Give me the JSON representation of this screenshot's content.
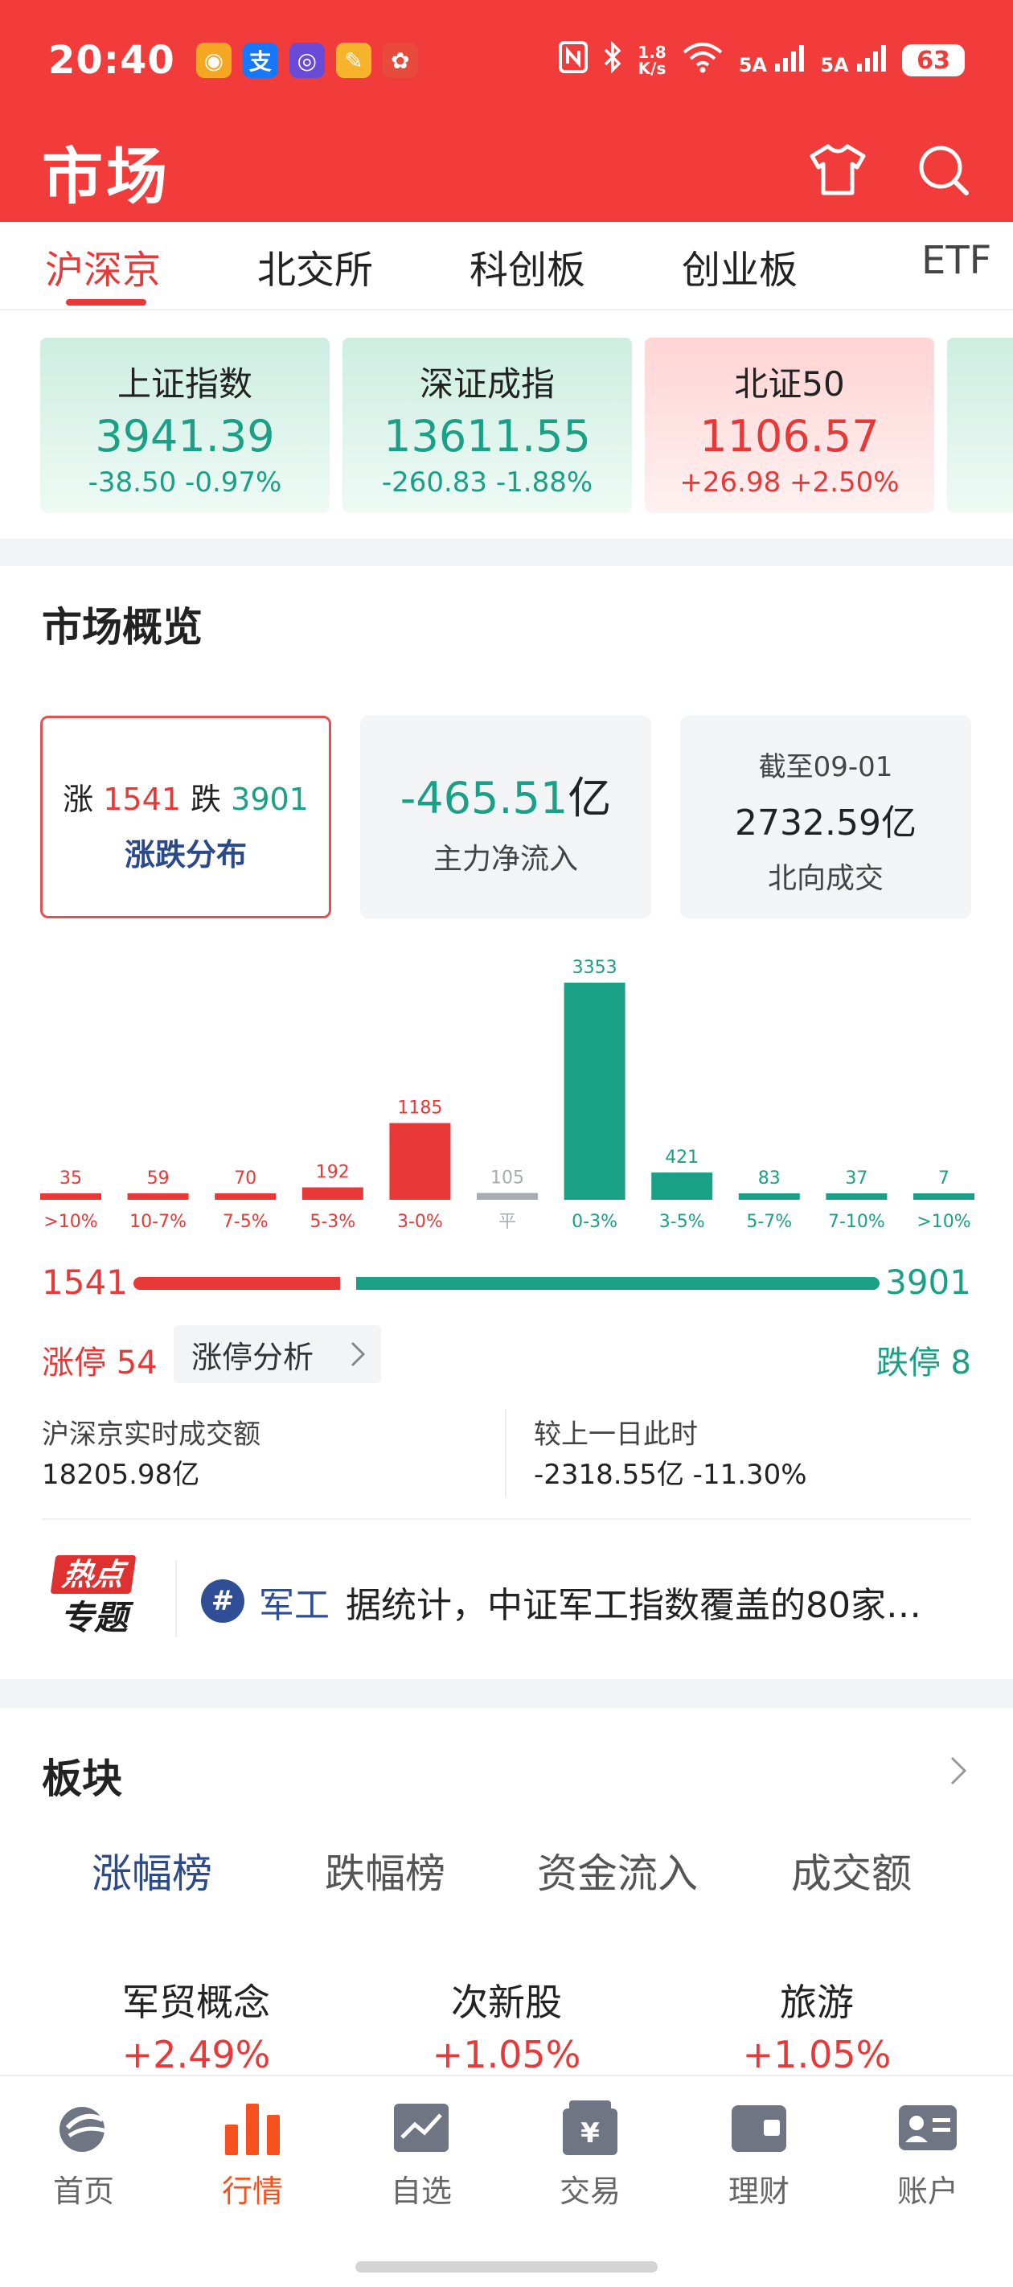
{
  "status_bar": {
    "time": "20:40",
    "net_speed_value": "1.8",
    "net_speed_unit": "K/s",
    "signal1": "5A",
    "signal2": "5A",
    "battery": "63",
    "app_icons": [
      {
        "icon": "chat-app-icon",
        "color": "#f5a623",
        "glyph": "◉"
      },
      {
        "icon": "alipay-icon",
        "color": "#1677ff",
        "glyph": "支"
      },
      {
        "icon": "game-app-icon",
        "color": "#6a4bd8",
        "glyph": "◎"
      },
      {
        "icon": "notes-app-icon",
        "color": "#f7b32b",
        "glyph": "✎"
      },
      {
        "icon": "cartoon-app-icon",
        "color": "#e84b3c",
        "glyph": "✿"
      }
    ]
  },
  "header": {
    "title": "市场"
  },
  "market_tabs": [
    "沪深京",
    "北交所",
    "科创板",
    "创业板",
    "ETF"
  ],
  "indices": [
    {
      "name": "上证指数",
      "value": "3941.39",
      "change": "-38.50 -0.97%",
      "direction": "down"
    },
    {
      "name": "深证成指",
      "value": "13611.55",
      "change": "-260.83 -1.88%",
      "direction": "down"
    },
    {
      "name": "北证50",
      "value": "1106.57",
      "change": "+26.98 +2.50%",
      "direction": "up"
    }
  ],
  "overview": {
    "title": "市场概览",
    "box1": {
      "up_label": "涨",
      "up_count": "1541",
      "down_label": "跌",
      "down_count": "3901",
      "caption": "涨跌分布"
    },
    "box2": {
      "value": "-465.51",
      "unit": "亿",
      "caption": "主力净流入"
    },
    "box3": {
      "date_label": "截至09-01",
      "value": "2732.59亿",
      "caption": "北向成交"
    },
    "up_total": "1541",
    "down_total": "3901",
    "limit_up": "涨停 54",
    "limit_analysis": "涨停分析",
    "limit_down": "跌停 8",
    "turnover_label": "沪深京实时成交额",
    "turnover_value": "18205.98亿",
    "compare_label": "较上一日此时",
    "compare_value": "-2318.55亿 -11.30%"
  },
  "chart_data": {
    "type": "bar",
    "categories": [
      ">10%",
      "10-7%",
      "7-5%",
      "5-3%",
      "3-0%",
      "平",
      "0-3%",
      "3-5%",
      "5-7%",
      "7-10%",
      ">10%"
    ],
    "values": [
      35,
      59,
      70,
      192,
      1185,
      105,
      3353,
      421,
      83,
      37,
      7
    ],
    "colors": [
      "#e83838",
      "#e83838",
      "#e83838",
      "#e83838",
      "#e83838",
      "#a9abb3",
      "#1aa085",
      "#1aa085",
      "#1aa085",
      "#1aa085",
      "#1aa085"
    ],
    "ylim": [
      0,
      3353
    ]
  },
  "hot_topic": {
    "badge_top": "热点",
    "badge_bottom": "专题",
    "tag": "军工",
    "text": "据统计，中证军工指数覆盖的80家…"
  },
  "sector": {
    "title": "板块",
    "tabs": [
      "涨幅榜",
      "跌幅榜",
      "资金流入",
      "成交额"
    ],
    "items": [
      {
        "name": "军贸概念",
        "pct": "+2.49%"
      },
      {
        "name": "次新股",
        "pct": "+1.05%"
      },
      {
        "name": "旅游",
        "pct": "+1.05%"
      }
    ]
  },
  "bottom_nav": [
    {
      "label": "首页",
      "icon": "home-icon"
    },
    {
      "label": "行情",
      "icon": "market-icon",
      "active": true
    },
    {
      "label": "自选",
      "icon": "watchlist-icon"
    },
    {
      "label": "交易",
      "icon": "trade-icon"
    },
    {
      "label": "理财",
      "icon": "wallet-icon"
    },
    {
      "label": "账户",
      "icon": "account-icon"
    }
  ],
  "colors": {
    "header_red": "#f23c3c",
    "rise": "#e83838",
    "fall": "#1aa085",
    "accent_blue": "#2b4a8a",
    "nav_active": "#f5501e"
  }
}
